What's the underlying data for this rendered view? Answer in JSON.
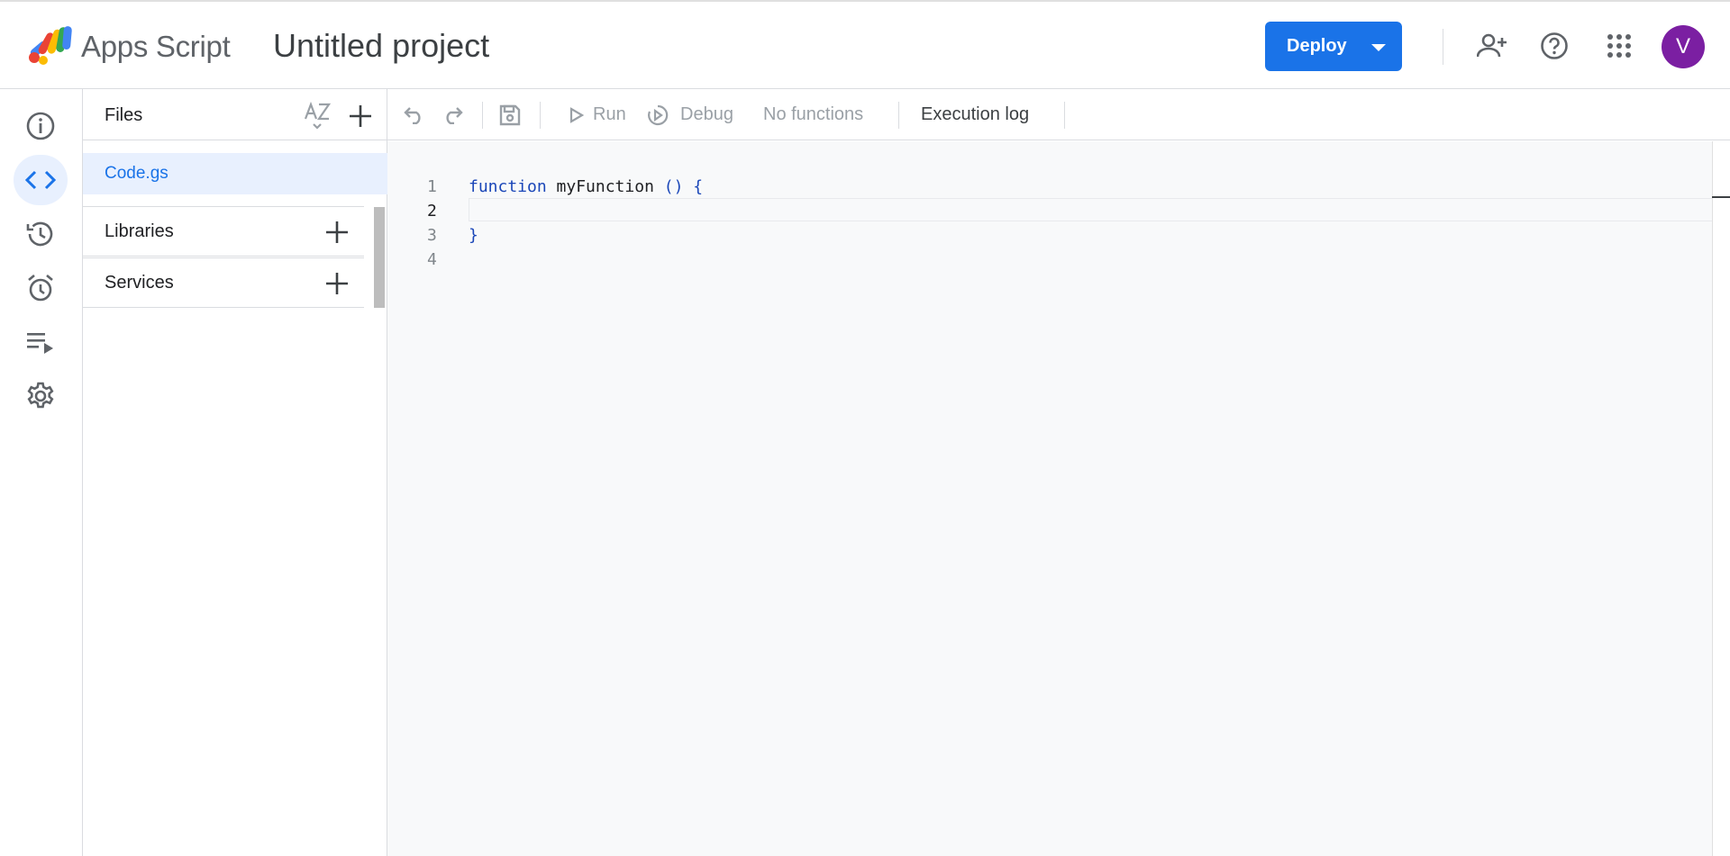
{
  "header": {
    "app_name": "Apps Script",
    "project_title": "Untitled project",
    "deploy_label": "Deploy",
    "avatar_initial": "V",
    "avatar_color": "#7b1fa2",
    "accent_color": "#1a73e8",
    "icons": [
      "add-person-icon",
      "help-icon",
      "apps-grid-icon"
    ]
  },
  "rail": {
    "items": [
      "info-icon",
      "code-icon",
      "history-icon",
      "alarm-icon",
      "executions-icon",
      "gear-icon"
    ],
    "active": "code-icon"
  },
  "files": {
    "title": "Files",
    "sort_icon": "sort-az-icon",
    "items": [
      {
        "name": "Code.gs",
        "selected": true
      }
    ],
    "sections": [
      {
        "label": "Libraries"
      },
      {
        "label": "Services"
      }
    ]
  },
  "toolbar": {
    "run_label": "Run",
    "debug_label": "Debug",
    "function_select": "No functions",
    "execution_log_label": "Execution log"
  },
  "editor": {
    "line_numbers": [
      "1",
      "2",
      "3",
      "4"
    ],
    "current_line": "2",
    "lines": [
      {
        "keyword": "function",
        "name": " myFunction",
        "punct": "() {"
      },
      {
        "text": ""
      },
      {
        "text": "}"
      },
      {
        "text": ""
      }
    ]
  }
}
